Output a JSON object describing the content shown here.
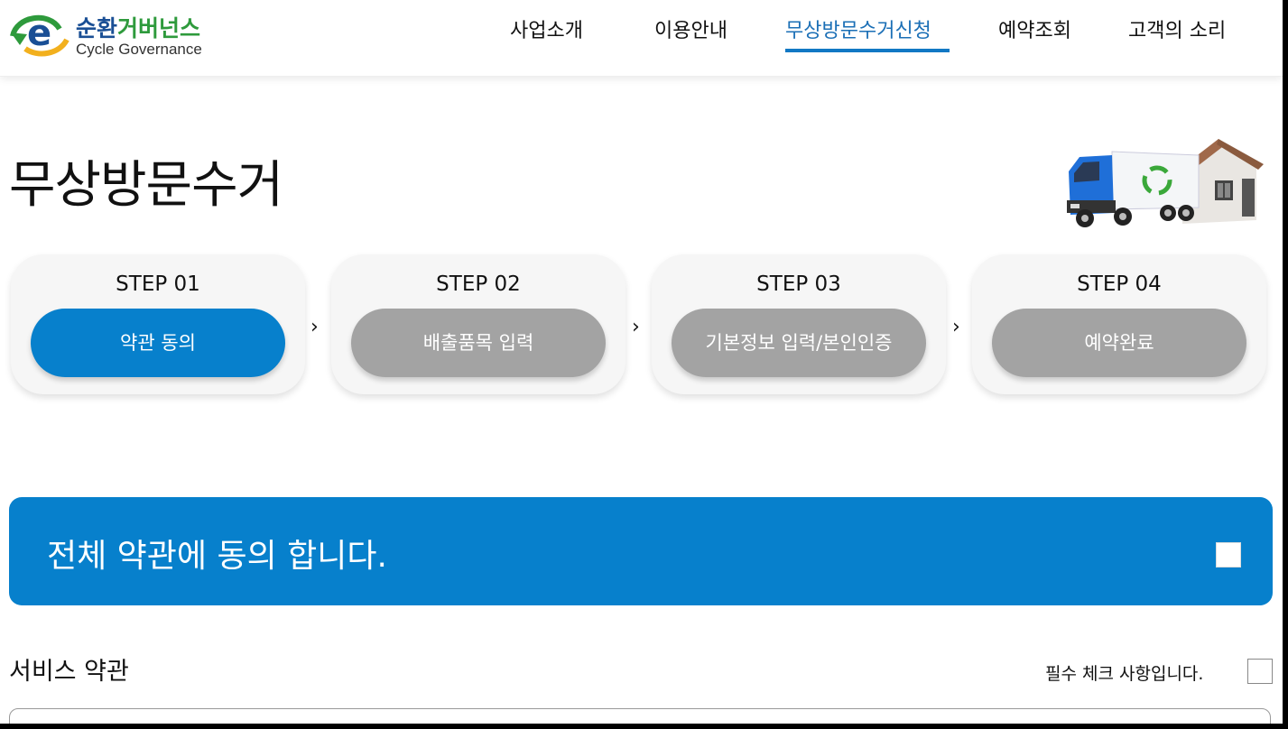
{
  "header": {
    "logo": {
      "name_ko_part1": "순환",
      "name_ko_part2": "거버넌스",
      "name_en": "Cycle Governance"
    },
    "nav": [
      {
        "label": "사업소개",
        "active": false
      },
      {
        "label": "이용안내",
        "active": false
      },
      {
        "label": "무상방문수거신청",
        "active": true
      },
      {
        "label": "예약조회",
        "active": false
      },
      {
        "label": "고객의 소리",
        "active": false
      }
    ]
  },
  "page": {
    "title": "무상방문수거"
  },
  "steps": [
    {
      "label": "STEP 01",
      "button": "약관 동의",
      "active": true
    },
    {
      "label": "STEP 02",
      "button": "배출품목 입력",
      "active": false
    },
    {
      "label": "STEP 03",
      "button": "기본정보 입력/본인인증",
      "active": false
    },
    {
      "label": "STEP 04",
      "button": "예약완료",
      "active": false
    }
  ],
  "agree_all": {
    "text": "전체 약관에 동의 합니다.",
    "checked": false
  },
  "service_terms": {
    "title": "서비스 약관",
    "required_text": "필수 체크 사항입니다.",
    "checked": false
  },
  "colors": {
    "primary": "#0780cc",
    "inactive": "#a3a3a3",
    "nav_active": "#1b6fb6"
  }
}
